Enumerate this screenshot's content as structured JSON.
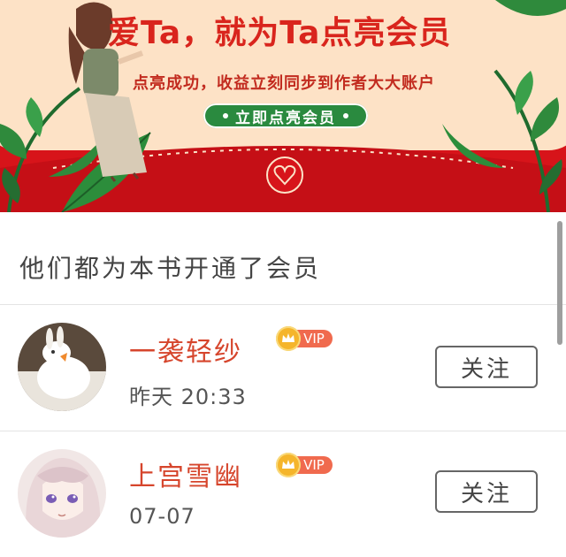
{
  "banner": {
    "title": "爱Ta，就为Ta点亮会员",
    "subtitle": "点亮成功，收益立刻同步到作者大大账户",
    "cta_label": "立即点亮会员",
    "colors": {
      "background": "#d7141a",
      "card": "#fde2c6",
      "cta": "#2a8a3f"
    }
  },
  "section": {
    "title": "他们都为本书开通了会员"
  },
  "members": [
    {
      "name": "一袭轻纱",
      "badge": "VIP",
      "time": "昨天 20:33",
      "follow_label": "关注",
      "avatar": "white-rabbit-avatar"
    },
    {
      "name": "上宫雪幽",
      "badge": "VIP",
      "time": "07-07",
      "follow_label": "关注",
      "avatar": "anime-girl-avatar"
    }
  ]
}
